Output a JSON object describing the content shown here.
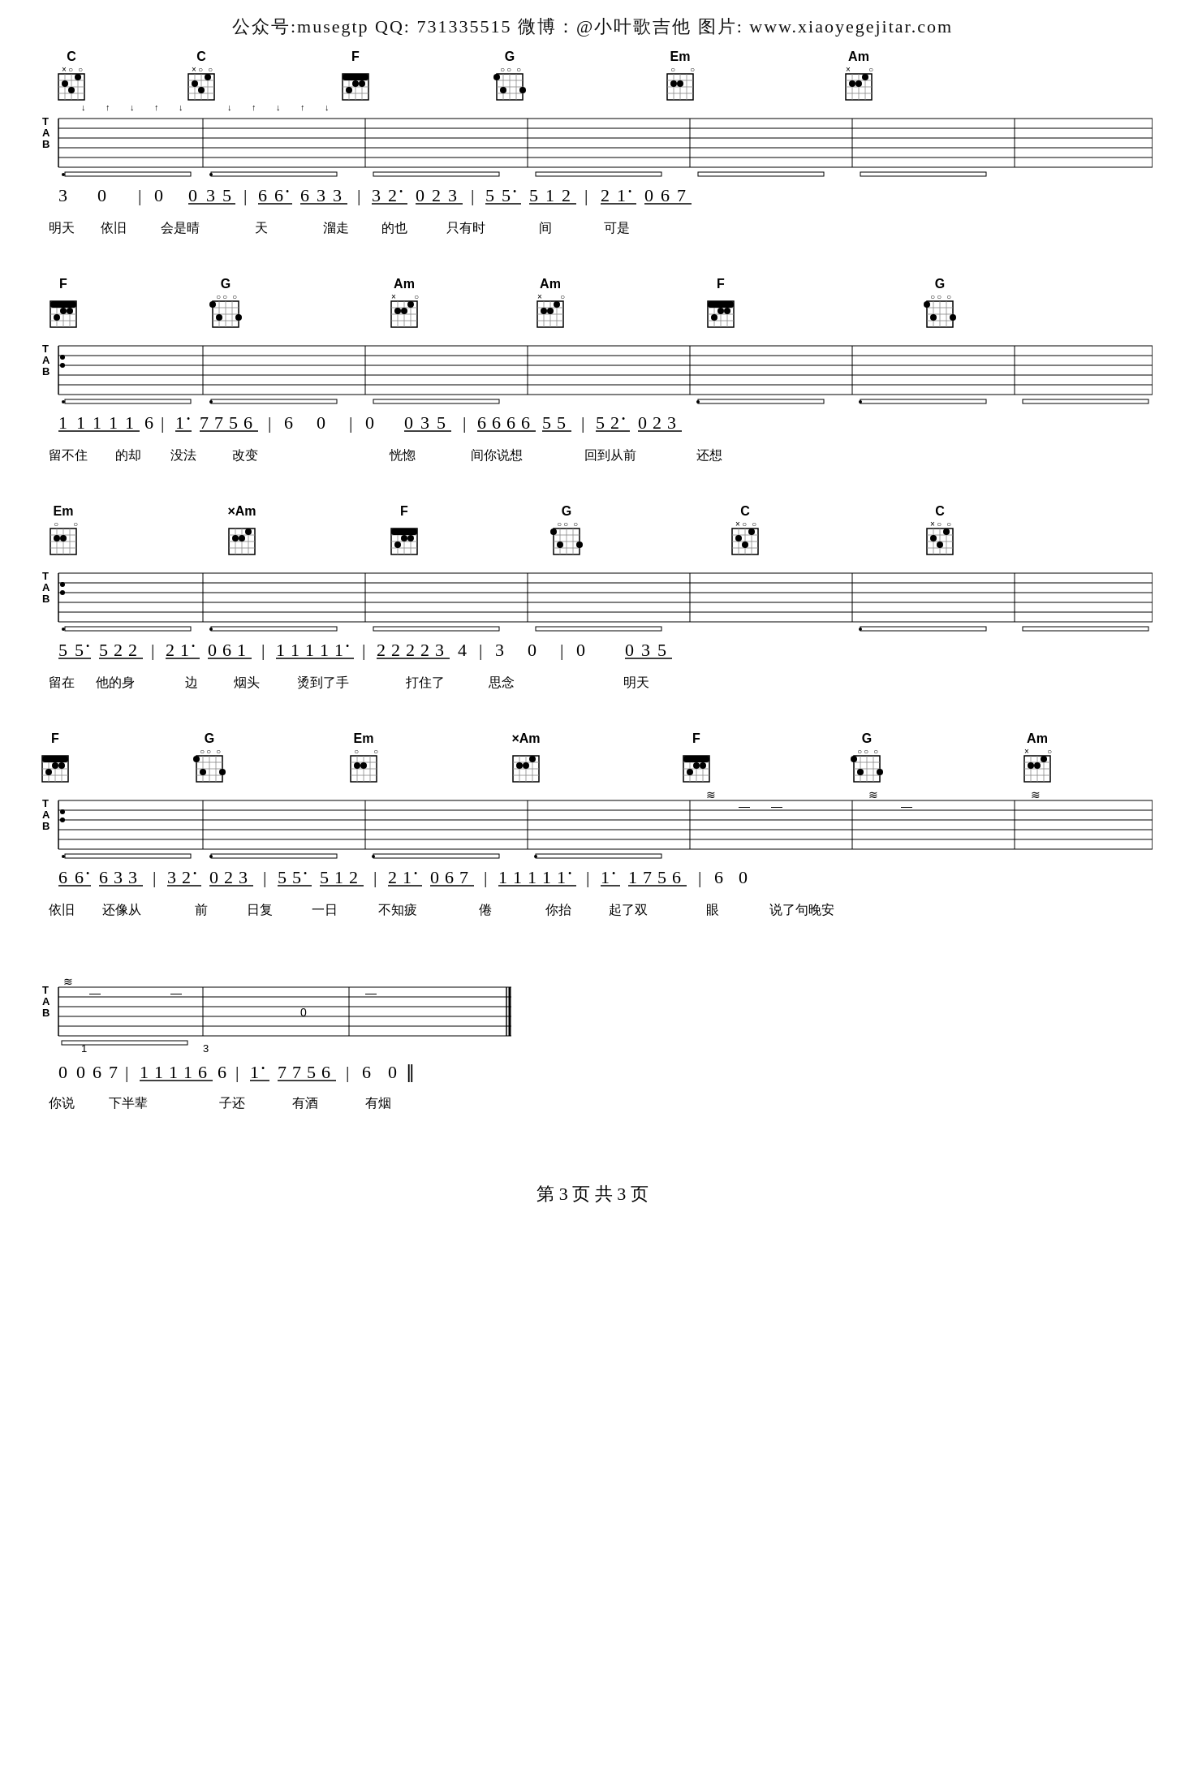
{
  "header": {
    "text": "公众号:musegtp   QQ: 731335515   微博：@小叶歌吉他   图片: www.xiaoyegejitar.com"
  },
  "sections": [
    {
      "id": "section1",
      "chords": [
        "C",
        "C",
        "F",
        "G",
        "Em",
        "Am"
      ],
      "notation": "3  0  |  0  <u>0 3 5</u> | <u>6 6•</u> <u>6 3 3</u> | <u>3 2•</u> <u>0 2 3</u> | <u>5 5•</u> <u>5 1 2</u> | <u>2 1•</u> <u>0 6 7</u>",
      "lyrics": "明天  依旧  会是晴  天    溜走  的也  只有时  间    可是"
    },
    {
      "id": "section2",
      "chords": [
        "F",
        "G",
        "Am",
        "Am",
        "F",
        "G"
      ],
      "notation": "<u>1 1 1 1 1</u> 6 | <u>1•</u> <u>7 7 5 6</u> | 6  0  |  0   <u>0 3 5</u> | <u>6 6 6 6</u> <u>5 5</u> | <u>5 2•</u> <u>0 2 3</u>",
      "lyrics": "留不住  的却  没法  改变                    恍惚  间你说想  回到从前    还想"
    },
    {
      "id": "section3",
      "chords": [
        "Em",
        "Am",
        "F",
        "G",
        "C",
        "C"
      ],
      "notation": "<u>5 5•</u> <u>5 2 2</u> | <u>2 1•</u> <u>0 6 1</u> | <u>1 1 1 1 1•</u> | <u>2 2 2 2 3</u> 4 | 3  0  |  0   <u>0 3 5</u>",
      "lyrics": "留在  他的身  边    烟头  烫到了手  打住了  思念                    明天"
    },
    {
      "id": "section4",
      "chords": [
        "F",
        "G",
        "Em",
        "Am",
        "F",
        "G",
        "Am"
      ],
      "notation": "<u>6 6•</u> <u>6 3 3</u> | <u>3 2•</u> <u>0 2 3</u> | <u>5 5•</u> <u>5 1 2</u> | <u>2 1•</u> <u>0 6 7</u> | <u>1 1 1 1 1•</u> | <u>1•</u> <u>1 7 5 6</u> | 6  0",
      "lyrics": "依旧  还像从  前    日复  一日  不知疲  倦    你抬  起了双  眼    说了句晚安"
    }
  ],
  "final_section": {
    "notation": "0  0 6 7 | <u>1 1 1 1 6</u> 6 | <u>1•</u> <u>7 7 5 6</u> | 6  0  ‖",
    "lyrics": "你说  下半辈  子还  有酒  有烟"
  },
  "footer": {
    "text": "第 3 页  共 3 页"
  }
}
